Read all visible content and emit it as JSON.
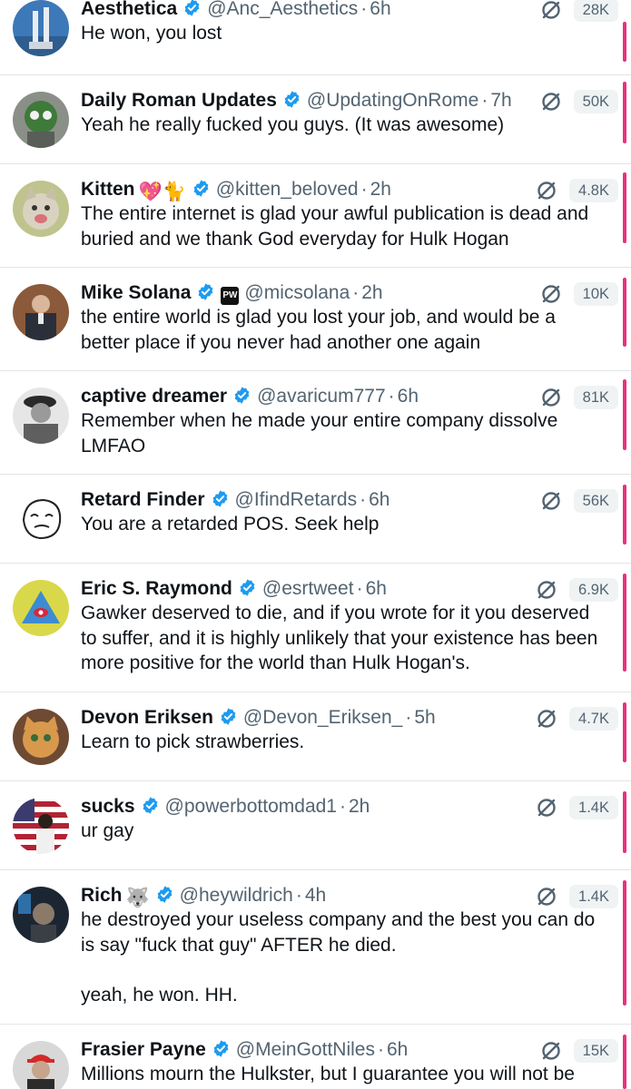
{
  "colors": {
    "verified_badge": "#1d9bf0",
    "accent_bar": "#e8317e",
    "secondary_text": "#536471",
    "separator": "#e1e5e8",
    "pill_bg": "#eff3f4"
  },
  "replies": [
    {
      "name": "Aesthetica",
      "emoji": "",
      "handle": "@Anc_Aesthetics",
      "time": "6h",
      "text": "He won, you lost",
      "count": "28K",
      "avatar_icon": "statue-avatar",
      "extra_badge": ""
    },
    {
      "name": "Daily Roman Updates",
      "emoji": "",
      "handle": "@UpdatingOnRome",
      "time": "7h",
      "text": "Yeah he really fucked you guys. (It was awesome)",
      "count": "50K",
      "avatar_icon": "roman-avatar",
      "extra_badge": ""
    },
    {
      "name": "Kitten",
      "emoji": "💖🐈",
      "handle": "@kitten_beloved",
      "time": "2h",
      "text": "The entire internet is glad your awful publication is dead and\nburied and we thank God everyday for Hulk Hogan",
      "count": "4.8K",
      "avatar_icon": "kitten-avatar",
      "extra_badge": ""
    },
    {
      "name": "Mike Solana",
      "emoji": "",
      "handle": "@micsolana",
      "time": "2h",
      "text": "the entire world is glad you lost your job, and would be a\nbetter place if you never had another one again",
      "count": "10K",
      "avatar_icon": "portrait-avatar",
      "extra_badge": "PW"
    },
    {
      "name": "captive dreamer",
      "emoji": "",
      "handle": "@avaricum777",
      "time": "6h",
      "text": "Remember when he made your entire company dissolve\nLMFAO",
      "count": "81K",
      "avatar_icon": "soldier-avatar",
      "extra_badge": ""
    },
    {
      "name": "Retard Finder",
      "emoji": "",
      "handle": "@IfindRetards",
      "time": "6h",
      "text": "You are a retarded POS. Seek help",
      "count": "56K",
      "avatar_icon": "meme-face-avatar",
      "extra_badge": ""
    },
    {
      "name": "Eric S. Raymond",
      "emoji": "",
      "handle": "@esrtweet",
      "time": "6h",
      "text": "Gawker deserved to die, and if you wrote for it you deserved\nto suffer, and it is highly unlikely that your existence has been\nmore positive for the world than Hulk Hogan's.",
      "count": "6.9K",
      "avatar_icon": "pyramid-avatar",
      "extra_badge": ""
    },
    {
      "name": "Devon Eriksen",
      "emoji": "",
      "handle": "@Devon_Eriksen_",
      "time": "5h",
      "text": "Learn to pick strawberries.",
      "count": "4.7K",
      "avatar_icon": "cat-avatar",
      "extra_badge": ""
    },
    {
      "name": "sucks",
      "emoji": "",
      "handle": "@powerbottomdad1",
      "time": "2h",
      "text": "ur gay",
      "count": "1.4K",
      "avatar_icon": "flag-avatar",
      "extra_badge": ""
    },
    {
      "name": "Rich",
      "emoji": "🐺",
      "handle": "@heywildrich",
      "time": "4h",
      "text": "he destroyed your useless company and the best you can do\nis say \"fuck that guy\" AFTER he died.\n\nyeah, he won. HH.",
      "count": "1.4K",
      "avatar_icon": "dark-room-avatar",
      "extra_badge": ""
    },
    {
      "name": "Frasier Payne",
      "emoji": "",
      "handle": "@MeinGottNiles",
      "time": "6h",
      "text": "Millions mourn the Hulkster, but I guarantee you will not be",
      "count": "15K",
      "avatar_icon": "red-cap-avatar",
      "extra_badge": ""
    }
  ]
}
